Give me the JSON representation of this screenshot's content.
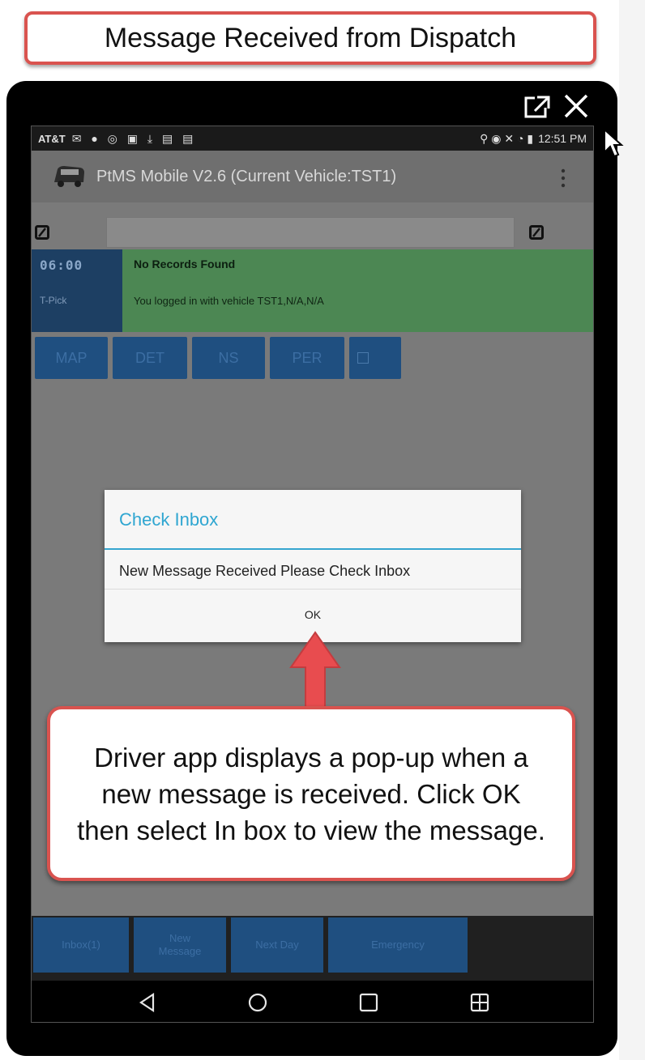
{
  "header_callout": {
    "text": "Message Received from Dispatch"
  },
  "status_bar": {
    "carrier": "AT&T",
    "notification_icons": "✉ ● ◎ ▣ ⤓ ▤ ▤",
    "status_icons": "⚲ ◉ ✕ ◔ ▮",
    "time": "12:51 PM"
  },
  "app_bar": {
    "title": "PtMS Mobile V2.6  (Current Vehicle:TST1)"
  },
  "record": {
    "time": "06:00",
    "label": "T-Pick",
    "title": "No Records Found",
    "message": "You logged in with vehicle TST1,N/A,N/A"
  },
  "action_buttons": [
    "MAP",
    "DET",
    "NS",
    "PER"
  ],
  "dialog": {
    "title": "Check Inbox",
    "message": "New Message Received Please Check Inbox",
    "ok_label": "OK"
  },
  "note_callout": {
    "text": "Driver app displays a pop-up when a new message is received.  Click OK then select In box to view the message."
  },
  "bottom_buttons": {
    "inbox": "Inbox(1)",
    "new_message": "New Message",
    "next_day": "Next Day",
    "emergency": "Emergency"
  },
  "colors": {
    "callout_border": "#d9534f",
    "dialog_accent": "#2fa6d1",
    "record_green": "#4c8753",
    "button_blue": "#1f4f80"
  }
}
